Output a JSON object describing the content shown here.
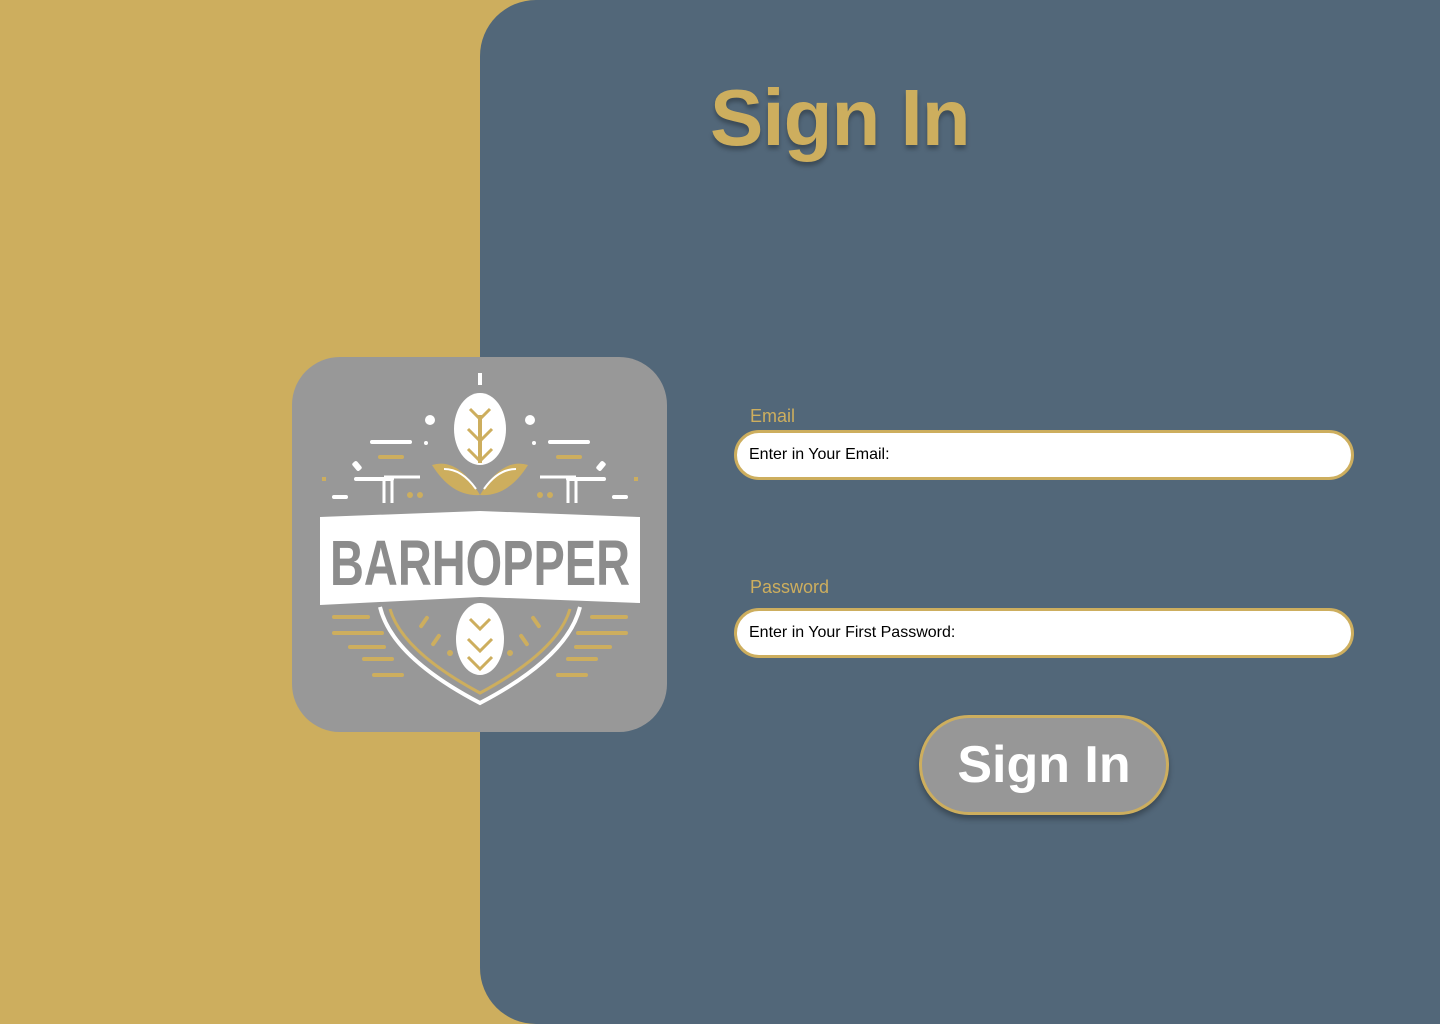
{
  "page": {
    "title": "Sign In"
  },
  "logo": {
    "wordmark": "BARHOPPER",
    "icon": "hop-cone-shield-icon"
  },
  "form": {
    "email": {
      "label": "Email",
      "placeholder": "Enter in Your Email:",
      "value": ""
    },
    "password": {
      "label": "Password",
      "placeholder": "Enter in Your First Password:",
      "value": ""
    },
    "submit_label": "Sign In"
  },
  "colors": {
    "gold": "#CDAE5E",
    "slate": "#526779",
    "gray": "#989898",
    "white": "#FFFFFF"
  }
}
